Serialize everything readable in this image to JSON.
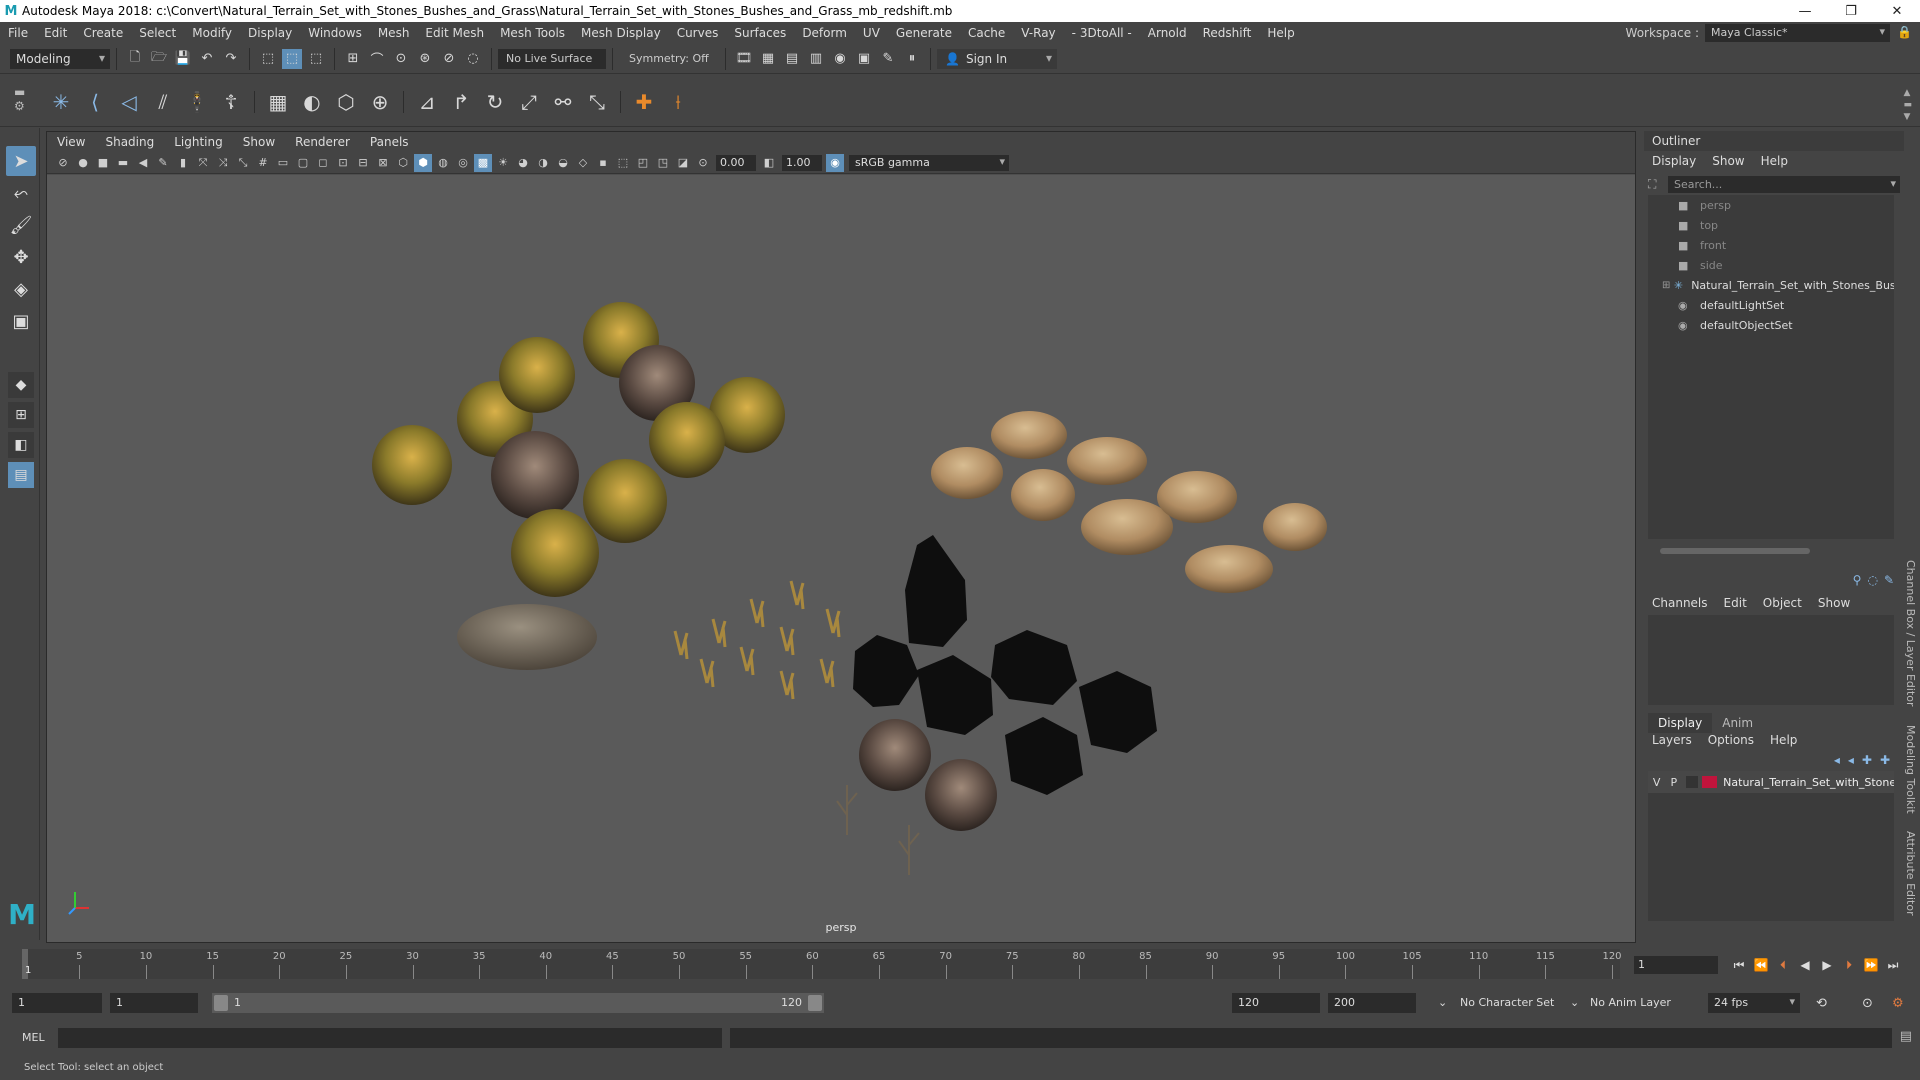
{
  "titlebar": {
    "title": "Autodesk Maya 2018: c:\\Convert\\Natural_Terrain_Set_with_Stones_Bushes_and_Grass\\Natural_Terrain_Set_with_Stones_Bushes_and_Grass_mb_redshift.mb",
    "minimize": "—",
    "maximize": "❐",
    "close": "✕"
  },
  "menubar": {
    "items": [
      "File",
      "Edit",
      "Create",
      "Select",
      "Modify",
      "Display",
      "Windows",
      "Mesh",
      "Edit Mesh",
      "Mesh Tools",
      "Mesh Display",
      "Curves",
      "Surfaces",
      "Deform",
      "UV",
      "Generate",
      "Cache",
      "V-Ray",
      "- 3DtoAll -",
      "Arnold",
      "Redshift",
      "Help"
    ],
    "workspace_label": "Workspace :",
    "workspace_value": "Maya Classic*"
  },
  "statusline": {
    "mode": "Modeling",
    "live_surface": "No Live Surface",
    "symmetry": "Symmetry: Off",
    "sign_in": "Sign In"
  },
  "panel": {
    "menus": [
      "View",
      "Shading",
      "Lighting",
      "Show",
      "Renderer",
      "Panels"
    ],
    "exposure": "0.00",
    "gamma_value": "1.00",
    "color_space": "sRGB gamma",
    "camera": "persp"
  },
  "outliner": {
    "title": "Outliner",
    "menus": [
      "Display",
      "Show",
      "Help"
    ],
    "search_placeholder": "Search...",
    "items": [
      {
        "label": "persp",
        "icon": "camera-icon"
      },
      {
        "label": "top",
        "icon": "camera-icon"
      },
      {
        "label": "front",
        "icon": "camera-icon"
      },
      {
        "label": "side",
        "icon": "camera-icon"
      },
      {
        "label": "Natural_Terrain_Set_with_Stones_Bushes_and_Grass",
        "icon": "group-icon"
      },
      {
        "label": "defaultLightSet",
        "icon": "set-icon"
      },
      {
        "label": "defaultObjectSet",
        "icon": "set-icon"
      }
    ]
  },
  "channelbox": {
    "menus": [
      "Channels",
      "Edit",
      "Object",
      "Show"
    ]
  },
  "layers": {
    "tabs": [
      "Display",
      "Anim"
    ],
    "menus": [
      "Layers",
      "Options",
      "Help"
    ],
    "row": {
      "v": "V",
      "p": "P",
      "name": "Natural_Terrain_Set_with_Stones",
      "color": "#c0143c"
    }
  },
  "side_tabs": [
    "Channel Box / Layer Editor",
    "Modeling Toolkit",
    "Attribute Editor"
  ],
  "timeline": {
    "ticks": [
      5,
      10,
      15,
      20,
      25,
      30,
      35,
      40,
      45,
      50,
      55,
      60,
      65,
      70,
      75,
      80,
      85,
      90,
      95,
      100,
      105,
      110,
      115,
      120
    ],
    "current_frame": "1",
    "frame_field": "1"
  },
  "range": {
    "start": "1",
    "anim_start": "1",
    "slider_start": "1",
    "slider_end": "120",
    "anim_end": "120",
    "end": "200",
    "character_set": "No Character Set",
    "anim_layer": "No Anim Layer",
    "fps": "24 fps"
  },
  "cmdline": {
    "label": "MEL"
  },
  "helpline": {
    "text": "Select Tool: select an object"
  }
}
